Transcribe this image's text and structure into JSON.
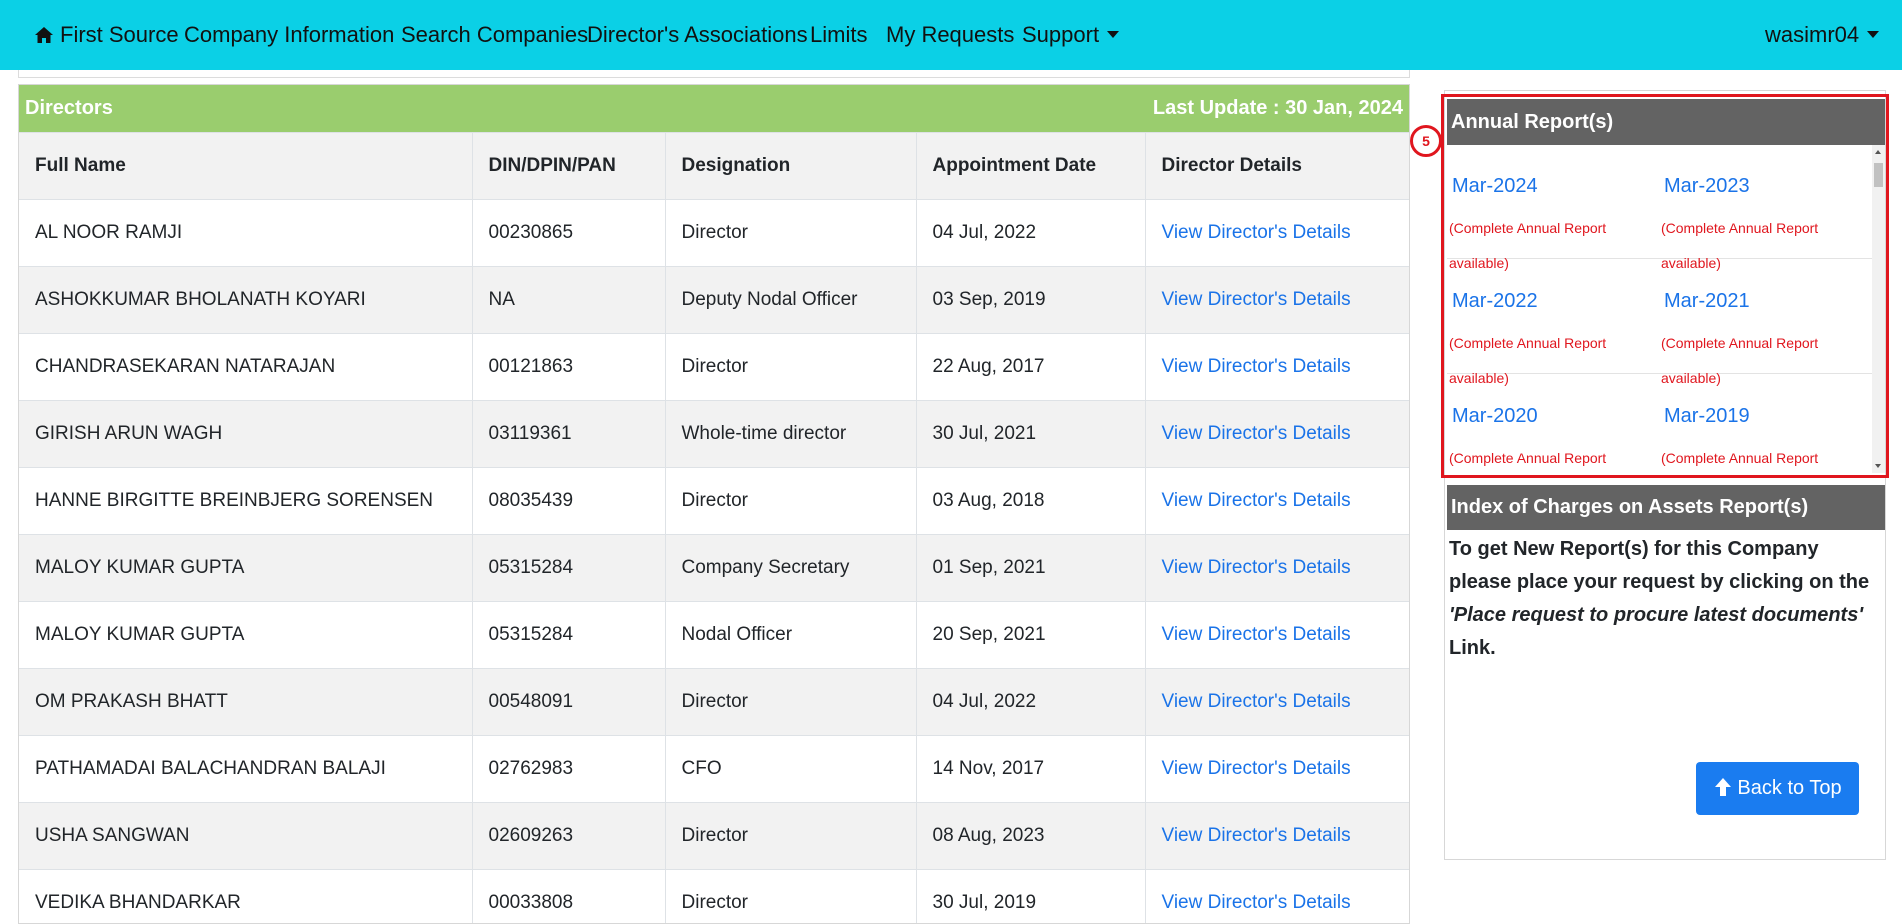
{
  "navbar": {
    "brand_label": "First Source",
    "items": [
      "Company Information",
      "Search Companies",
      "Director's Associations",
      "Limits",
      "My Requests",
      "Support"
    ],
    "user_label": "wasimr04",
    "bg_color": "#0bd0e6"
  },
  "directors": {
    "title": "Directors",
    "last_update": "Last Update : 30 Jan, 2024",
    "header_color": "#9acd6e",
    "columns": [
      "Full Name",
      "DIN/DPIN/PAN",
      "Designation",
      "Appointment Date",
      "Director Details"
    ],
    "rows": [
      {
        "name": "AL NOOR RAMJI",
        "din": "00230865",
        "designation": "Director",
        "date": "04 Jul, 2022",
        "link": "View Director's Details"
      },
      {
        "name": "ASHOKKUMAR BHOLANATH KOYARI",
        "din": "NA",
        "designation": "Deputy Nodal Officer",
        "date": "03 Sep, 2019",
        "link": "View Director's Details"
      },
      {
        "name": "CHANDRASEKARAN NATARAJAN",
        "din": "00121863",
        "designation": "Director",
        "date": "22 Aug, 2017",
        "link": "View Director's Details"
      },
      {
        "name": "GIRISH ARUN WAGH",
        "din": "03119361",
        "designation": "Whole-time director",
        "date": "30 Jul, 2021",
        "link": "View Director's Details"
      },
      {
        "name": "HANNE BIRGITTE BREINBJERG SORENSEN",
        "din": "08035439",
        "designation": "Director",
        "date": "03 Aug, 2018",
        "link": "View Director's Details"
      },
      {
        "name": "MALOY KUMAR GUPTA",
        "din": "05315284",
        "designation": "Company Secretary",
        "date": "01 Sep, 2021",
        "link": "View Director's Details"
      },
      {
        "name": "MALOY KUMAR GUPTA",
        "din": "05315284",
        "designation": "Nodal Officer",
        "date": "20 Sep, 2021",
        "link": "View Director's Details"
      },
      {
        "name": "OM PRAKASH BHATT",
        "din": "00548091",
        "designation": "Director",
        "date": "04 Jul, 2022",
        "link": "View Director's Details"
      },
      {
        "name": "PATHAMADAI BALACHANDRAN BALAJI",
        "din": "02762983",
        "designation": "CFO",
        "date": "14 Nov, 2017",
        "link": "View Director's Details"
      },
      {
        "name": "USHA SANGWAN",
        "din": "02609263",
        "designation": "Director",
        "date": "08 Aug, 2023",
        "link": "View Director's Details"
      },
      {
        "name": "VEDIKA BHANDARKAR",
        "din": "00033808",
        "designation": "Director",
        "date": "30 Jul, 2019",
        "link": "View Director's Details"
      }
    ]
  },
  "annual_reports": {
    "title": "Annual Report(s)",
    "badge": "5",
    "rows": [
      [
        {
          "year": "Mar-2024",
          "note": "(Complete Annual Report available)"
        },
        {
          "year": "Mar-2023",
          "note": "(Complete Annual Report available)"
        }
      ],
      [
        {
          "year": "Mar-2022",
          "note": "(Complete Annual Report available)"
        },
        {
          "year": "Mar-2021",
          "note": "(Complete Annual Report available)"
        }
      ],
      [
        {
          "year": "Mar-2020",
          "note": "(Complete Annual Report"
        },
        {
          "year": "Mar-2019",
          "note": "(Complete Annual Report"
        }
      ]
    ]
  },
  "charges": {
    "title": "Index of Charges on Assets Report(s)",
    "text_before": "To get New Report(s) for this Company please place your request by clicking on the ",
    "text_em": "'Place request to procure latest documents'",
    "text_after": " Link."
  },
  "back_to_top": "Back to Top"
}
